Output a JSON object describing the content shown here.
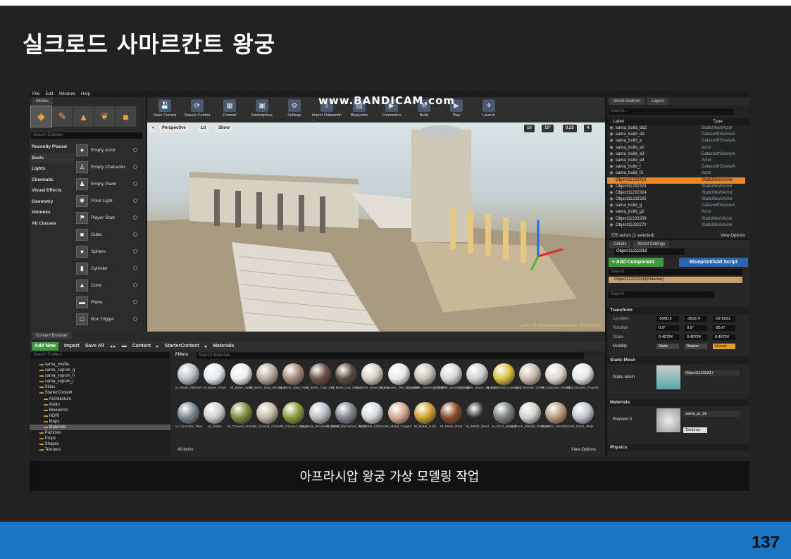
{
  "slide": {
    "title": "실크로드 사마르칸트 왕궁",
    "caption": "아프라시압 왕궁 가상 모델링 작업",
    "page_number": "137",
    "colors": {
      "footer": "#1a74c4",
      "background": "#222222"
    }
  },
  "editor": {
    "menu": [
      "File",
      "Edit",
      "Window",
      "Help"
    ],
    "watermark": "www.BANDICAM.com",
    "modes": {
      "tab": "Modes",
      "search_placeholder": "Search Classes",
      "categories": [
        "Recently Placed",
        "Basic",
        "Lights",
        "Cinematic",
        "Visual Effects",
        "Geometry",
        "Volumes",
        "All Classes"
      ],
      "classes": [
        {
          "label": "Empty Actor",
          "icon": "sphere-icon"
        },
        {
          "label": "Empty Character",
          "icon": "character-icon"
        },
        {
          "label": "Empty Pawn",
          "icon": "pawn-icon"
        },
        {
          "label": "Point Light",
          "icon": "light-icon"
        },
        {
          "label": "Player Start",
          "icon": "player-start-icon"
        },
        {
          "label": "Cube",
          "icon": "cube-icon"
        },
        {
          "label": "Sphere",
          "icon": "sphere-icon"
        },
        {
          "label": "Cylinder",
          "icon": "cylinder-icon"
        },
        {
          "label": "Cone",
          "icon": "cone-icon"
        },
        {
          "label": "Plane",
          "icon": "plane-icon"
        },
        {
          "label": "Box Trigger",
          "icon": "box-trigger-icon"
        }
      ]
    },
    "toolbar": [
      "Save Current",
      "Source Control",
      "Content",
      "Marketplace",
      "Settings",
      "Import Datasmith ...",
      "Blueprints",
      "Cinematics",
      "Build",
      "Play",
      "Launch"
    ],
    "viewport": {
      "perspective": "Perspective",
      "lit": "Lit",
      "show": "Show",
      "grid": "10",
      "angle": "10°",
      "scale": "0.25",
      "camera": "4",
      "level_label": "Level: FirstPersonExampleMap (Persistent)"
    },
    "outliner": {
      "tab1": "World Outliner",
      "tab2": "Layers",
      "search_placeholder": "Search...",
      "col_label": "Label",
      "col_type": "Type",
      "rows": [
        {
          "label": "sama_build_dd2",
          "type": "StaticMeshActor"
        },
        {
          "label": "sama_build_d3",
          "type": "DatasmithSceneA"
        },
        {
          "label": "sama_build_e",
          "type": "DatasmithSceneA"
        },
        {
          "label": "sama_build_e2",
          "type": "Actor"
        },
        {
          "label": "sama_build_e3",
          "type": "DatasmithSceneA"
        },
        {
          "label": "sama_build_e4",
          "type": "Actor"
        },
        {
          "label": "sama_build_f",
          "type": "DatasmithSceneA"
        },
        {
          "label": "sama_build_f2",
          "type": "Actor"
        },
        {
          "label": "Object11232318",
          "type": "StaticMeshActor"
        },
        {
          "label": "Object11232323",
          "type": "StaticMeshActor"
        },
        {
          "label": "Object11232324",
          "type": "StaticMeshActor"
        },
        {
          "label": "Object11232325",
          "type": "StaticMeshActor"
        },
        {
          "label": "sama_build_g",
          "type": "DatasmithSceneA"
        },
        {
          "label": "sama_build_g2",
          "type": "Actor"
        },
        {
          "label": "Object11232269",
          "type": "StaticMeshActor"
        },
        {
          "label": "Object11232270",
          "type": "StaticMeshActor"
        }
      ],
      "selected_index": 8,
      "count": "570 actors (1 selected)",
      "view_options": "View Options"
    },
    "details": {
      "tab1": "Details",
      "tab2": "World Settings",
      "object_name": "Object11232318",
      "add_component": "+ Add Component",
      "blueprint": "Blueprint/Add Script",
      "search_placeholder": "Search",
      "instance": "Object11232318(Instance)",
      "transform": "Transform",
      "location_label": "Location",
      "rotation_label": "Rotation",
      "scale_label": "Scale",
      "mobility_label": "Mobility",
      "location": [
        "-5990.5",
        "-3522.4",
        "-92.6931"
      ],
      "rotation": [
        "0.0°",
        "0.0°",
        "-85.6°"
      ],
      "scale": [
        "0.40724",
        "0.40724",
        "0.40724"
      ],
      "mobility": [
        "Static",
        "Station",
        "Movab"
      ],
      "static_mesh_section": "Static Mesh",
      "static_mesh_label": "Static Mesh",
      "static_mesh_value": "Object11232317",
      "materials_section": "Materials",
      "element_label": "Element 0",
      "material_value": "sama_pr_bb",
      "material_source": "Textures",
      "physics_section": "Physics"
    },
    "content_browser": {
      "tab": "Content Browser",
      "add_new": "Add New",
      "import": "Import",
      "save_all": "Save All",
      "path": [
        "Content",
        "StarterContent",
        "Materials"
      ],
      "folder_search": "Search Folders",
      "filters": "Filters",
      "asset_search": "Search Materials",
      "folders": [
        {
          "label": "sama_modle",
          "sel": false
        },
        {
          "label": "sama_sopum_g",
          "sel": false
        },
        {
          "label": "sama_sopum_h",
          "sel": false
        },
        {
          "label": "sama_sopum_i",
          "sel": false
        },
        {
          "label": "Skies",
          "sel": false
        },
        {
          "label": "StarterContent",
          "sel": false
        },
        {
          "label": "Architecture",
          "sel": false
        },
        {
          "label": "Audio",
          "sel": false
        },
        {
          "label": "Blueprints",
          "sel": false
        },
        {
          "label": "HDRI",
          "sel": false
        },
        {
          "label": "Maps",
          "sel": false
        },
        {
          "label": "Materials",
          "sel": true
        },
        {
          "label": "Particles",
          "sel": false
        },
        {
          "label": "Props",
          "sel": false
        },
        {
          "label": "Shapes",
          "sel": false
        },
        {
          "label": "Textures",
          "sel": false
        }
      ],
      "assets_row1": [
        {
          "name": "M_Asset_Platform",
          "color": "#b9bfc4"
        },
        {
          "name": "M_Basic_Floor",
          "color": "#e5ecf2"
        },
        {
          "name": "M_Basic_Wall",
          "color": "#eeeeee"
        },
        {
          "name": "M_Brick_Clay_Beveled",
          "color": "#b9a89a"
        },
        {
          "name": "M_Brick_Clay_New",
          "color": "#a58b7a"
        },
        {
          "name": "M_Brick_Clay_Old",
          "color": "#6b5040"
        },
        {
          "name": "M_Brick_Cut_Stone",
          "color": "#5a4a3a"
        },
        {
          "name": "M_Brick_Hewn_Stone",
          "color": "#d2cdc2"
        },
        {
          "name": "M_Ceramic_Tile_Checker",
          "color": "#e8e8e8"
        },
        {
          "name": "M_Cobble_Stone_Pebble",
          "color": "#c8c0b4"
        },
        {
          "name": "M_Cobble_Stone_Rough",
          "color": "#d8d8d8"
        },
        {
          "name": "M_Cobble_Stone_Smooth",
          "color": "#cfcfcf"
        },
        {
          "name": "M_ColorGrid_LowSpec",
          "color": "#d8c040"
        },
        {
          "name": "M_Concrete_Grime",
          "color": "#c9bca9"
        },
        {
          "name": "M_Concrete_Panels",
          "color": "#dcd6cc"
        },
        {
          "name": "M_Concrete_Poured",
          "color": "#e6e6e6"
        }
      ],
      "assets_row2": [
        {
          "name": "M_Concrete_Tiles",
          "color": "#7b8690"
        },
        {
          "name": "M_Glass",
          "color": "#cfcfcf"
        },
        {
          "name": "M_Ground_Grass",
          "color": "#7c8c40"
        },
        {
          "name": "M_Ground_Gravel",
          "color": "#c4b8a4"
        },
        {
          "name": "M_Ground_Moss",
          "color": "#8a9a3a"
        },
        {
          "name": "M_Metal_Brushed_Nickel",
          "color": "#b8bec6"
        },
        {
          "name": "M_Metal_Burnished_Steel",
          "color": "#7f878d"
        },
        {
          "name": "M_Metal_Chrome",
          "color": "#d4dadc"
        },
        {
          "name": "M_Metal_Copper",
          "color": "#d8a890"
        },
        {
          "name": "M_Metal_Gold",
          "color": "#d0a030"
        },
        {
          "name": "M_Metal_Rust",
          "color": "#8a4a2a"
        },
        {
          "name": "M_Metal_Steel",
          "color": "#2a2a2a"
        },
        {
          "name": "M_Rock_Basalt",
          "color": "#7a8080"
        },
        {
          "name": "M_Rock_Marble_Polished",
          "color": "#d0d0c8"
        },
        {
          "name": "M_Rock_Sandstone",
          "color": "#b89a7a"
        },
        {
          "name": "M_Rock_Slate",
          "color": "#c0c8cc"
        }
      ],
      "item_count": "43 items",
      "view_options": "View Options"
    }
  }
}
